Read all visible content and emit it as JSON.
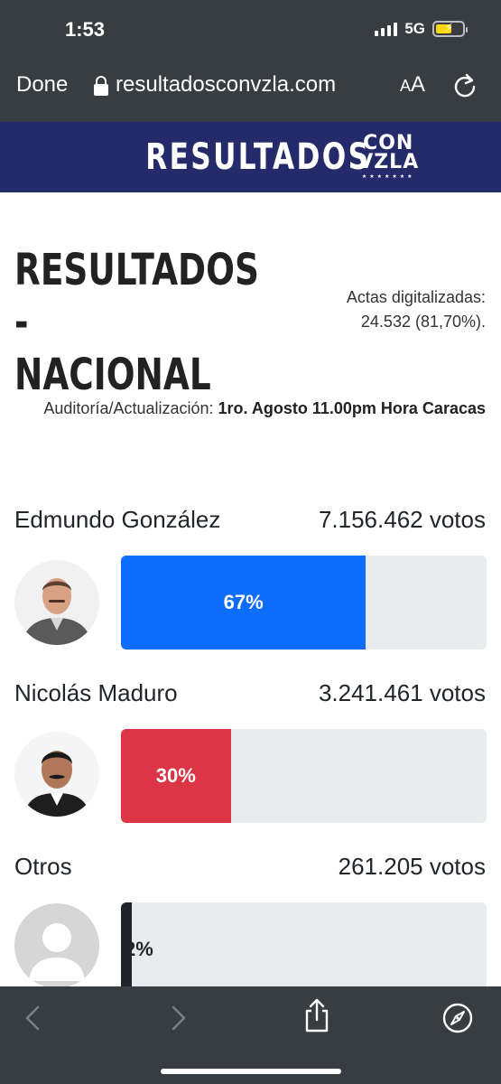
{
  "status_bar": {
    "time": "1:53",
    "network": "5G"
  },
  "browser": {
    "done_label": "Done",
    "url": "resultadosconvzla.com",
    "text_size_label": "AA"
  },
  "site": {
    "logo_word": "RESULTADOS",
    "logo_badge_line1": "CON",
    "logo_badge_line2": "VZLA",
    "logo_stars": "★★★★★★★"
  },
  "main": {
    "title": "RESULTADOS - NACIONAL",
    "actas_line1": "Actas digitalizadas:",
    "actas_line2": "24.532 (81,70%).",
    "audit_label": "Auditoría/Actualización:",
    "audit_value": "1ro. Agosto 11.00pm Hora Caracas"
  },
  "candidates": [
    {
      "name": "Edmundo González",
      "votes": "7.156.462 votos",
      "percent_label": "67%",
      "percent": 67,
      "color": "#0d6efd"
    },
    {
      "name": "Nicolás Maduro",
      "votes": "3.241.461 votos",
      "percent_label": "30%",
      "percent": 30,
      "color": "#dc3545"
    },
    {
      "name": "Otros",
      "votes": "261.205 votos",
      "percent_label": "2%",
      "percent": 3,
      "color": "#212529"
    }
  ],
  "colors": {
    "chrome": "#383d42",
    "header": "#252b6a",
    "bar_track": "#e9ecef"
  },
  "toolbar": {
    "icons": [
      "back-icon",
      "forward-icon",
      "share-icon",
      "compass-icon"
    ]
  }
}
